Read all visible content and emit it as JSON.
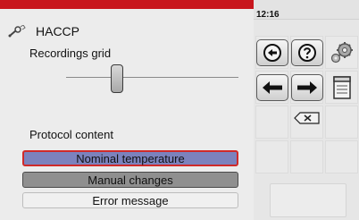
{
  "status": {
    "time": "12:16"
  },
  "header": {
    "title": "HACCP",
    "icon": "wrench-icon"
  },
  "recordings": {
    "label": "Recordings grid"
  },
  "protocol": {
    "label": "Protocol content",
    "options": [
      {
        "label": "Nominal temperature",
        "state": "selected"
      },
      {
        "label": "Manual changes",
        "state": "active"
      },
      {
        "label": "Error message",
        "state": "inactive"
      }
    ]
  },
  "toolbar": {
    "buttons": [
      {
        "icon": "back-circle-icon"
      },
      {
        "icon": "help-icon"
      },
      {
        "icon": "settings-gears-icon"
      },
      {
        "icon": "arrow-left-icon"
      },
      {
        "icon": "arrow-right-icon"
      },
      {
        "icon": "document-icon"
      },
      {
        "icon": "backspace-icon"
      }
    ]
  },
  "colors": {
    "topbar": "#c8161d",
    "selected_fill": "#7c82bd",
    "selected_border": "#cf2a2a",
    "active_fill": "#8f8f8f"
  }
}
